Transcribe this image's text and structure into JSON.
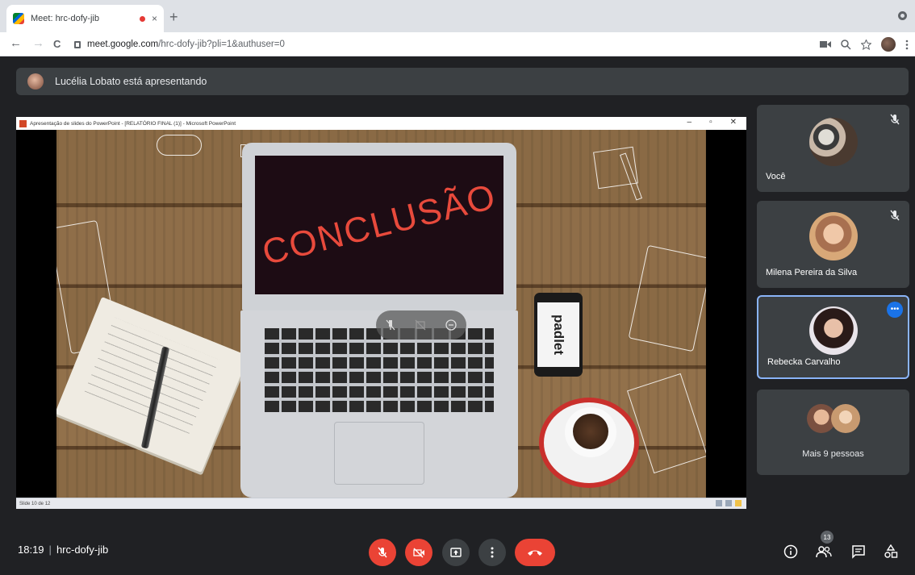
{
  "browser": {
    "tab_title": "Meet: hrc-dofy-jib",
    "tab_close": "×",
    "new_tab": "+",
    "url_host": "meet.google.com",
    "url_path": "/hrc-dofy-jib?pli=1&authuser=0",
    "nav_back": "←",
    "nav_forward": "→",
    "nav_reload": "C"
  },
  "presenting": {
    "text": "Lucélia Lobato está apresentando"
  },
  "powerpoint": {
    "window_title": "Apresentação de slides do PowerPoint - [RELATÓRIO FINAL (1)] - Microsoft PowerPoint",
    "minimize": "–",
    "restore": "▫",
    "close": "✕",
    "status": "Slide 10 de 12",
    "slide_heading": "CONCLUSÃO",
    "phone_logo": "padlet"
  },
  "participants": [
    {
      "name": "Você",
      "muted": true
    },
    {
      "name": "Milena Pereira da Silva",
      "muted": true
    },
    {
      "name": "Rebecka Carvalho",
      "active": true,
      "more": "•••"
    },
    {
      "name": "Mais 9 pessoas"
    }
  ],
  "bottom": {
    "time": "18:19",
    "separator": "|",
    "meeting_code": "hrc-dofy-jib",
    "people_count": "13"
  },
  "colors": {
    "background": "#202124",
    "tile": "#3c4043",
    "danger": "#ea4335",
    "accent": "#8ab4f8",
    "slide_text": "#e84a3c"
  },
  "icons": {
    "mic": "mic-off-icon",
    "camera": "camera-off-icon",
    "present": "present-now-icon",
    "more": "more-vert-icon",
    "hangup": "call-end-icon",
    "info": "info-icon",
    "people": "people-icon",
    "chat": "chat-icon",
    "activities": "activities-icon"
  }
}
